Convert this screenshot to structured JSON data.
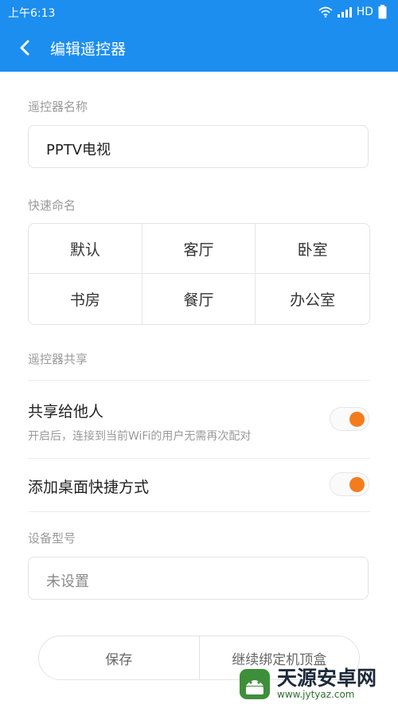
{
  "status_bar": {
    "time": "上午6:13",
    "network": "HD"
  },
  "app_bar": {
    "title": "编辑遥控器"
  },
  "remote_name": {
    "label": "遥控器名称",
    "value": "PPTV电视"
  },
  "quick_naming": {
    "label": "快速命名",
    "options": [
      "默认",
      "客厅",
      "卧室",
      "书房",
      "餐厅",
      "办公室"
    ]
  },
  "sharing": {
    "section_label": "遥控器共享",
    "share_title": "共享给他人",
    "share_desc": "开启后，连接到当前WiFi的用户无需再次配对",
    "share_enabled": true,
    "shortcut_title": "添加桌面快捷方式",
    "shortcut_enabled": true
  },
  "device_model": {
    "label": "设备型号",
    "placeholder": "未设置"
  },
  "buttons": {
    "save": "保存",
    "continue_bind": "继续绑定机顶盒"
  },
  "watermark": {
    "title": "天源安卓网",
    "url": "www.jytyaz.com"
  },
  "colors": {
    "primary": "#1c8ef0",
    "toggle_on": "#f47c1e"
  }
}
